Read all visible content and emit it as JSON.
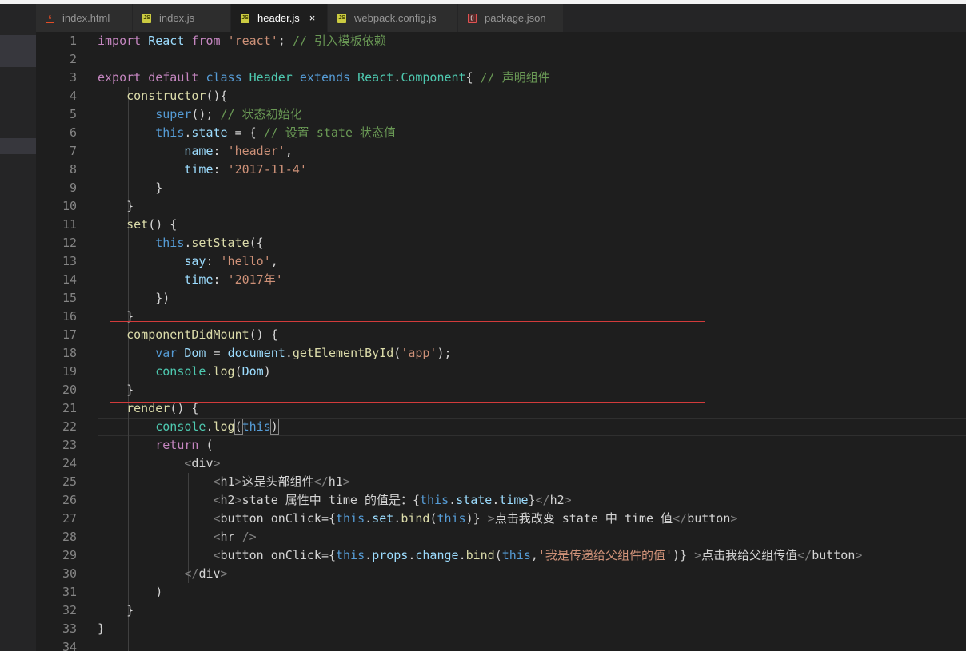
{
  "tabs": [
    {
      "label": "index.html",
      "icon": "html-file-icon",
      "active": false
    },
    {
      "label": "index.js",
      "icon": "js-file-icon",
      "active": false
    },
    {
      "label": "header.js",
      "icon": "js-file-icon",
      "active": true
    },
    {
      "label": "webpack.config.js",
      "icon": "js-file-icon",
      "active": false
    },
    {
      "label": "package.json",
      "icon": "json-file-icon",
      "active": false
    }
  ],
  "close_glyph": "×",
  "highlight_color": "#d23b3b",
  "editor": {
    "line_numbers": [
      "1",
      "2",
      "3",
      "4",
      "5",
      "6",
      "7",
      "8",
      "9",
      "10",
      "11",
      "12",
      "13",
      "14",
      "15",
      "16",
      "17",
      "18",
      "19",
      "20",
      "21",
      "22",
      "23",
      "24",
      "25",
      "26",
      "27",
      "28",
      "29",
      "30",
      "31",
      "32",
      "33",
      "34"
    ],
    "lines": [
      [
        {
          "t": "kw2",
          "v": "import"
        },
        {
          "t": "p",
          "v": " "
        },
        {
          "t": "var",
          "v": "React"
        },
        {
          "t": "p",
          "v": " "
        },
        {
          "t": "kw2",
          "v": "from"
        },
        {
          "t": "p",
          "v": " "
        },
        {
          "t": "str",
          "v": "'react'"
        },
        {
          "t": "p",
          "v": "; "
        },
        {
          "t": "cmt",
          "v": "// 引入模板依赖"
        }
      ],
      [],
      [
        {
          "t": "kw2",
          "v": "export"
        },
        {
          "t": "p",
          "v": " "
        },
        {
          "t": "kw2",
          "v": "default"
        },
        {
          "t": "p",
          "v": " "
        },
        {
          "t": "kw",
          "v": "class"
        },
        {
          "t": "p",
          "v": " "
        },
        {
          "t": "cls",
          "v": "Header"
        },
        {
          "t": "p",
          "v": " "
        },
        {
          "t": "kw",
          "v": "extends"
        },
        {
          "t": "p",
          "v": " "
        },
        {
          "t": "cls",
          "v": "React"
        },
        {
          "t": "p",
          "v": "."
        },
        {
          "t": "cls",
          "v": "Component"
        },
        {
          "t": "p",
          "v": "{ "
        },
        {
          "t": "cmt",
          "v": "// 声明组件"
        }
      ],
      [
        {
          "t": "p",
          "v": "    "
        },
        {
          "t": "fn",
          "v": "constructor"
        },
        {
          "t": "p",
          "v": "(){"
        }
      ],
      [
        {
          "t": "p",
          "v": "        "
        },
        {
          "t": "kw",
          "v": "super"
        },
        {
          "t": "p",
          "v": "(); "
        },
        {
          "t": "cmt",
          "v": "// 状态初始化"
        }
      ],
      [
        {
          "t": "p",
          "v": "        "
        },
        {
          "t": "kw",
          "v": "this"
        },
        {
          "t": "p",
          "v": "."
        },
        {
          "t": "var",
          "v": "state"
        },
        {
          "t": "p",
          "v": " = { "
        },
        {
          "t": "cmt",
          "v": "// 设置 state 状态值"
        }
      ],
      [
        {
          "t": "p",
          "v": "            "
        },
        {
          "t": "var",
          "v": "name"
        },
        {
          "t": "p",
          "v": ": "
        },
        {
          "t": "str",
          "v": "'header'"
        },
        {
          "t": "p",
          "v": ","
        }
      ],
      [
        {
          "t": "p",
          "v": "            "
        },
        {
          "t": "var",
          "v": "time"
        },
        {
          "t": "p",
          "v": ": "
        },
        {
          "t": "str",
          "v": "'2017-11-4'"
        }
      ],
      [
        {
          "t": "p",
          "v": "        }"
        }
      ],
      [
        {
          "t": "p",
          "v": "    }"
        }
      ],
      [
        {
          "t": "p",
          "v": "    "
        },
        {
          "t": "fn",
          "v": "set"
        },
        {
          "t": "p",
          "v": "() {"
        }
      ],
      [
        {
          "t": "p",
          "v": "        "
        },
        {
          "t": "kw",
          "v": "this"
        },
        {
          "t": "p",
          "v": "."
        },
        {
          "t": "fn",
          "v": "setState"
        },
        {
          "t": "p",
          "v": "({"
        }
      ],
      [
        {
          "t": "p",
          "v": "            "
        },
        {
          "t": "var",
          "v": "say"
        },
        {
          "t": "p",
          "v": ": "
        },
        {
          "t": "str",
          "v": "'hello'"
        },
        {
          "t": "p",
          "v": ","
        }
      ],
      [
        {
          "t": "p",
          "v": "            "
        },
        {
          "t": "var",
          "v": "time"
        },
        {
          "t": "p",
          "v": ": "
        },
        {
          "t": "str",
          "v": "'2017年'"
        }
      ],
      [
        {
          "t": "p",
          "v": "        })"
        }
      ],
      [
        {
          "t": "p",
          "v": "    }"
        }
      ],
      [
        {
          "t": "p",
          "v": "    "
        },
        {
          "t": "fn",
          "v": "componentDidMount"
        },
        {
          "t": "p",
          "v": "() {"
        }
      ],
      [
        {
          "t": "p",
          "v": "        "
        },
        {
          "t": "kw",
          "v": "var"
        },
        {
          "t": "p",
          "v": " "
        },
        {
          "t": "var",
          "v": "Dom"
        },
        {
          "t": "p",
          "v": " = "
        },
        {
          "t": "var",
          "v": "document"
        },
        {
          "t": "p",
          "v": "."
        },
        {
          "t": "fn",
          "v": "getElementById"
        },
        {
          "t": "p",
          "v": "("
        },
        {
          "t": "str",
          "v": "'app'"
        },
        {
          "t": "p",
          "v": ");"
        }
      ],
      [
        {
          "t": "p",
          "v": "        "
        },
        {
          "t": "cls",
          "v": "console"
        },
        {
          "t": "p",
          "v": "."
        },
        {
          "t": "fn",
          "v": "log"
        },
        {
          "t": "p",
          "v": "("
        },
        {
          "t": "var",
          "v": "Dom"
        },
        {
          "t": "p",
          "v": ")"
        }
      ],
      [
        {
          "t": "p",
          "v": "    }"
        }
      ],
      [
        {
          "t": "p",
          "v": "    "
        },
        {
          "t": "fn",
          "v": "render"
        },
        {
          "t": "p",
          "v": "() {"
        }
      ],
      [
        {
          "t": "p",
          "v": "        "
        },
        {
          "t": "cls",
          "v": "console"
        },
        {
          "t": "p",
          "v": "."
        },
        {
          "t": "fn",
          "v": "log"
        },
        {
          "t": "brk",
          "v": "("
        },
        {
          "t": "kw",
          "v": "this"
        },
        {
          "t": "brk",
          "v": ")"
        }
      ],
      [
        {
          "t": "p",
          "v": "        "
        },
        {
          "t": "kw2",
          "v": "return"
        },
        {
          "t": "p",
          "v": " ("
        }
      ],
      [
        {
          "t": "p",
          "v": "            "
        },
        {
          "t": "tag",
          "v": "<"
        },
        {
          "t": "tagname",
          "v": "div"
        },
        {
          "t": "tag",
          "v": ">"
        }
      ],
      [
        {
          "t": "p",
          "v": "                "
        },
        {
          "t": "tag",
          "v": "<"
        },
        {
          "t": "tagname",
          "v": "h1"
        },
        {
          "t": "tag",
          "v": ">"
        },
        {
          "t": "p",
          "v": "这是头部组件"
        },
        {
          "t": "tag",
          "v": "</"
        },
        {
          "t": "tagname",
          "v": "h1"
        },
        {
          "t": "tag",
          "v": ">"
        }
      ],
      [
        {
          "t": "p",
          "v": "                "
        },
        {
          "t": "tag",
          "v": "<"
        },
        {
          "t": "tagname",
          "v": "h2"
        },
        {
          "t": "tag",
          "v": ">"
        },
        {
          "t": "p",
          "v": "state 属性中 time 的值是："
        },
        {
          "t": "p",
          "v": "{"
        },
        {
          "t": "kw",
          "v": "this"
        },
        {
          "t": "p",
          "v": "."
        },
        {
          "t": "var",
          "v": "state"
        },
        {
          "t": "p",
          "v": "."
        },
        {
          "t": "var",
          "v": "time"
        },
        {
          "t": "p",
          "v": "}"
        },
        {
          "t": "tag",
          "v": "</"
        },
        {
          "t": "tagname",
          "v": "h2"
        },
        {
          "t": "tag",
          "v": ">"
        }
      ],
      [
        {
          "t": "p",
          "v": "                "
        },
        {
          "t": "tag",
          "v": "<"
        },
        {
          "t": "tagname",
          "v": "button"
        },
        {
          "t": "p",
          "v": " "
        },
        {
          "t": "attr",
          "v": "onClick"
        },
        {
          "t": "p",
          "v": "={"
        },
        {
          "t": "kw",
          "v": "this"
        },
        {
          "t": "p",
          "v": "."
        },
        {
          "t": "var",
          "v": "set"
        },
        {
          "t": "p",
          "v": "."
        },
        {
          "t": "fn",
          "v": "bind"
        },
        {
          "t": "p",
          "v": "("
        },
        {
          "t": "kw",
          "v": "this"
        },
        {
          "t": "p",
          "v": ")} "
        },
        {
          "t": "tag",
          "v": ">"
        },
        {
          "t": "p",
          "v": "点击我改变 state 中 time 值"
        },
        {
          "t": "tag",
          "v": "</"
        },
        {
          "t": "tagname",
          "v": "button"
        },
        {
          "t": "tag",
          "v": ">"
        }
      ],
      [
        {
          "t": "p",
          "v": "                "
        },
        {
          "t": "tag",
          "v": "<"
        },
        {
          "t": "tagname",
          "v": "hr"
        },
        {
          "t": "p",
          "v": " "
        },
        {
          "t": "tag",
          "v": "/>"
        }
      ],
      [
        {
          "t": "p",
          "v": "                "
        },
        {
          "t": "tag",
          "v": "<"
        },
        {
          "t": "tagname",
          "v": "button"
        },
        {
          "t": "p",
          "v": " "
        },
        {
          "t": "attr",
          "v": "onClick"
        },
        {
          "t": "p",
          "v": "={"
        },
        {
          "t": "kw",
          "v": "this"
        },
        {
          "t": "p",
          "v": "."
        },
        {
          "t": "var",
          "v": "props"
        },
        {
          "t": "p",
          "v": "."
        },
        {
          "t": "var",
          "v": "change"
        },
        {
          "t": "p",
          "v": "."
        },
        {
          "t": "fn",
          "v": "bind"
        },
        {
          "t": "p",
          "v": "("
        },
        {
          "t": "kw",
          "v": "this"
        },
        {
          "t": "p",
          "v": ","
        },
        {
          "t": "str",
          "v": "'我是传递给父组件的值'"
        },
        {
          "t": "p",
          "v": ")} "
        },
        {
          "t": "tag",
          "v": ">"
        },
        {
          "t": "p",
          "v": "点击我给父组传值"
        },
        {
          "t": "tag",
          "v": "</"
        },
        {
          "t": "tagname",
          "v": "button"
        },
        {
          "t": "tag",
          "v": ">"
        }
      ],
      [
        {
          "t": "p",
          "v": "            "
        },
        {
          "t": "tag",
          "v": "</"
        },
        {
          "t": "tagname",
          "v": "div"
        },
        {
          "t": "tag",
          "v": ">"
        }
      ],
      [
        {
          "t": "p",
          "v": "        )"
        }
      ],
      [
        {
          "t": "p",
          "v": "    }"
        }
      ],
      [
        {
          "t": "p",
          "v": "}"
        }
      ],
      []
    ]
  }
}
